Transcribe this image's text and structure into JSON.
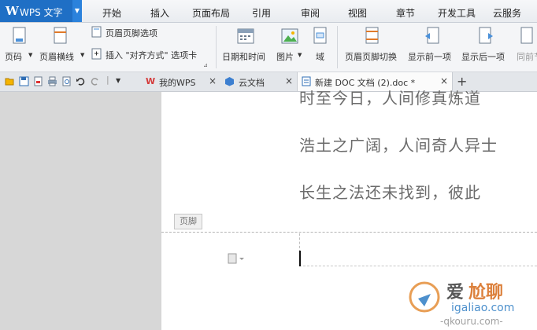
{
  "app": {
    "logo_text": "WPS 文字"
  },
  "menu": {
    "items": [
      "开始",
      "插入",
      "页面布局",
      "引用",
      "审阅",
      "视图",
      "章节",
      "开发工具",
      "云服务"
    ]
  },
  "ribbon": {
    "page_number": "页码",
    "header_line": "页眉横线",
    "header_footer_options": "页眉页脚选项",
    "insert_align_tab": "插入 \"对齐方式\" 选项卡",
    "date_time": "日期和时间",
    "picture": "图片",
    "field": "域",
    "switch_header_footer": "页眉页脚切换",
    "show_previous": "显示前一项",
    "show_next": "显示后一项",
    "same_as_previous": "同前节"
  },
  "tabs": {
    "my_wps": "我的WPS",
    "cloud_docs": "云文档",
    "new_doc": "新建 DOC 文档 (2).doc *",
    "close": "×",
    "add": "+"
  },
  "document": {
    "lines": [
      "时至今日，人间修真炼道",
      "浩土之广阔，人间奇人异士",
      "长生之法还未找到，彼此"
    ],
    "footer_label": "页脚"
  },
  "watermark": {
    "brand": "爱",
    "brand2": "尬聊",
    "site": "igaliao.com",
    "site2": "-qkouru.com-"
  },
  "colors": {
    "accent": "#1f6fc5",
    "page": "#ffffff",
    "text": "#6b6b6b"
  }
}
